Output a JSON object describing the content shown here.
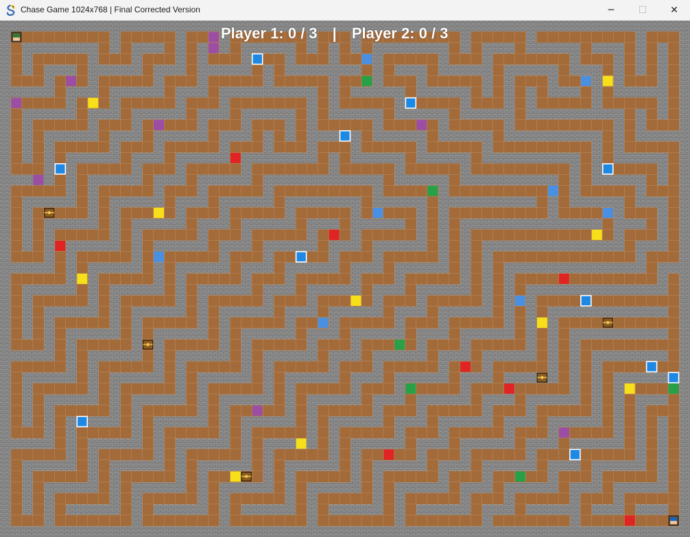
{
  "window": {
    "title": "Chase Game 1024x768 | Final Corrected Version",
    "app_icon": "snake-app-icon",
    "controls": {
      "minimize": "─",
      "maximize": "☐",
      "close": "✕"
    }
  },
  "hud": {
    "player1": "Player 1: 0 / 3",
    "separator": "|",
    "player2": "Player 2: 0 / 3"
  },
  "colors": {
    "floor": "#a36a3a",
    "wall": "#8e8e8e",
    "wall_line": "#6f6f6f",
    "purple": "#9b4ea3",
    "blue": "#4a90e2",
    "blue_bright": "#1e88e5",
    "green": "#27a047",
    "red": "#e02424",
    "yellow": "#f7e01a",
    "chest": "#8b5a1e"
  },
  "maze": {
    "cols": 63,
    "rows": 47,
    "rowsData": [
      "###############################################################",
      "#.........#.....#...#.......#...#.........#.....#.........#...#",
      "#.#######.#.###.#.#.#.#####.#.#.#.#######.#.###.#####.###.#.#.#",
      "#.#.....#...#...#.#...#...#...#...#.....#...#.......#...#.#.#.#",
      "#.#.###.#####.###.#####.#.#######.#.###.#####.#####.###.#.#.#.#",
      "#...#...#.....#...#.....#.....#...#...#.....#.#...#...#.#...#.#",
      "#####.###.#####.###.#########.#.#####.#####.#.#.#.###.#.#####.#",
      "#.....#...#.....#...#.......#.#.....#.....#...#.#.....#.....#.#",
      "#.#####.###.#####.###.#####.#.#####.#####.#####.#########.#.#.#",
      "#.#.....#...#.....#...#...#.#.....#.....#.....#.........#.#...#",
      "#.#.#####.###.#####.###.#.#.#####.#####.#####.#########.#.#####",
      "#.#.#.....#...#.....#...#...#...#.....#.....#.........#.#.....#",
      "#.#.#.#####.###.#####.#######.#.#####.#####.#########.#.#####.#",
      "#...#.#.....#...#.....#.......#.....#.....#.........#.#.....#.#",
      "#####.#.#####.###.#####.###########.#####.#########.#.#####.#.#",
      "#.....#.#.....#...#.....#.........#.....#.........#.#.....#...#",
      "#.#####.#.#####.###.#####.#######.#####.#########.#.#####.###.#",
      "#.#.....#.#.....#...#.....#.....#.....#.#.........#.....#...#.#",
      "#.#.#####.#.#####.###.#####.###.#####.#.#.#############.###.#.#",
      "#.#.#.....#.#.....#...#.....#...#.....#.#.#.............#...#.#",
      "#.#.#.#####.#.#####.###.#####.###.#####.#.#.#############.###.#",
      "#...#.#.....#.#.....#...#.....#...#.....#.#.#.............#...#",
      "#####.#.#####.#.#####.###.#####.###.#####.#.#.#############.###",
      "#.....#.#.....#.#.....#...#.....#...#.....#.#.#.............#.#",
      "#.#####.#.#####.#.#####.###.#####.###.#####.#.#.#############.#",
      "#.#.....#.#.....#.#.....#...#.....#...#.....#.#.#.............#",
      "#.#.#####.#.#####.#.#####.###.#####.###.#####.#.#.###########.#",
      "#.#.#.....#.#.....#.#.....#...#.....#...#.....#.#.#...........#",
      "#.#.#.#####.#.#####.#.#####.###.#####.###.#####.#.#.#########.#",
      "#...#.#.....#.#.....#.#.....#...#.....#...#.....#.#.#.........#",
      "#####.#.#####.#.#####.#.#####.###.#####.###.#####.#.#.#######.#",
      "#.....#.#.....#.#.....#.#.....#...#.....#...#.....#.#.#.......#",
      "#.#####.#.#####.#.#####.#.#####.###.#####.###.#####.#.#.#####.#",
      "#.#.....#.#.....#.#.....#.#.....#...#.....#...#.....#.#.#.....#",
      "#.#.#####.#.#####.#.#####.#.#####.###.#####.###.#####.#.#.###.#",
      "#.#.#.....#.#.....#.#.....#.#.....#...#.....#...#.....#.#.#...#",
      "#.#.#.#####.#.#####.#.#####.#.#####.###.#####.###.#####.#.#.#.#",
      "#...#.#.....#.#.....#.#.....#.#.....#...#.....#...#.....#.#.#.#",
      "#####.#.#####.#.#####.#.#####.#.#####.###.#####.###.#####.#.#.#",
      "#.....#.#.....#.#.....#.#.....#.#.....#...#.....#...#.....#.#.#",
      "#.#####.#.#####.#.#####.#.#####.#.#####.###.#####.###.#####.#.#",
      "#.#.....#.#.....#.#.....#.#.....#.#.....#...#.....#...#.....#.#",
      "#.#.#####.#.#####.#.#####.#.#####.#.#####.###.#####.###.#####.#",
      "#.#.#.....#.#.....#.#.....#.#.....#.#.....#...#.....#...#.....#",
      "#.#.#.#####.#.#####.#.#####.#.#####.#.#####.###.#####.###.###.#",
      "#...#.......#.......#.......#.......#.......#.......#.........#",
      "###############################################################"
    ]
  },
  "items": [
    {
      "c": 19,
      "r": 1,
      "t": "purple"
    },
    {
      "c": 19,
      "r": 2,
      "t": "purple"
    },
    {
      "c": 23,
      "r": 3,
      "t": "blue_bright"
    },
    {
      "c": 33,
      "r": 3,
      "t": "blue"
    },
    {
      "c": 6,
      "r": 5,
      "t": "purple"
    },
    {
      "c": 33,
      "r": 5,
      "t": "green"
    },
    {
      "c": 53,
      "r": 5,
      "t": "blue"
    },
    {
      "c": 55,
      "r": 5,
      "t": "yellow"
    },
    {
      "c": 1,
      "r": 7,
      "t": "purple"
    },
    {
      "c": 8,
      "r": 7,
      "t": "yellow"
    },
    {
      "c": 37,
      "r": 7,
      "t": "blue_bright"
    },
    {
      "c": 14,
      "r": 9,
      "t": "purple"
    },
    {
      "c": 38,
      "r": 9,
      "t": "purple"
    },
    {
      "c": 31,
      "r": 10,
      "t": "blue_bright"
    },
    {
      "c": 21,
      "r": 12,
      "t": "red"
    },
    {
      "c": 5,
      "r": 13,
      "t": "blue_bright"
    },
    {
      "c": 55,
      "r": 13,
      "t": "blue_bright"
    },
    {
      "c": 3,
      "r": 14,
      "t": "purple"
    },
    {
      "c": 39,
      "r": 15,
      "t": "green"
    },
    {
      "c": 50,
      "r": 15,
      "t": "blue"
    },
    {
      "c": 4,
      "r": 17,
      "t": "chest"
    },
    {
      "c": 14,
      "r": 17,
      "t": "yellow"
    },
    {
      "c": 34,
      "r": 17,
      "t": "blue"
    },
    {
      "c": 55,
      "r": 17,
      "t": "blue"
    },
    {
      "c": 30,
      "r": 19,
      "t": "red"
    },
    {
      "c": 54,
      "r": 19,
      "t": "yellow"
    },
    {
      "c": 5,
      "r": 20,
      "t": "red"
    },
    {
      "c": 14,
      "r": 21,
      "t": "blue"
    },
    {
      "c": 27,
      "r": 21,
      "t": "blue_bright"
    },
    {
      "c": 7,
      "r": 23,
      "t": "yellow"
    },
    {
      "c": 51,
      "r": 23,
      "t": "red"
    },
    {
      "c": 32,
      "r": 25,
      "t": "yellow"
    },
    {
      "c": 47,
      "r": 25,
      "t": "blue"
    },
    {
      "c": 53,
      "r": 25,
      "t": "blue_bright"
    },
    {
      "c": 29,
      "r": 27,
      "t": "blue"
    },
    {
      "c": 49,
      "r": 27,
      "t": "yellow"
    },
    {
      "c": 55,
      "r": 27,
      "t": "chest"
    },
    {
      "c": 13,
      "r": 29,
      "t": "chest"
    },
    {
      "c": 36,
      "r": 29,
      "t": "green"
    },
    {
      "c": 42,
      "r": 31,
      "t": "red"
    },
    {
      "c": 59,
      "r": 31,
      "t": "blue_bright"
    },
    {
      "c": 49,
      "r": 32,
      "t": "chest"
    },
    {
      "c": 61,
      "r": 32,
      "t": "blue_bright"
    },
    {
      "c": 37,
      "r": 33,
      "t": "green"
    },
    {
      "c": 46,
      "r": 33,
      "t": "red"
    },
    {
      "c": 57,
      "r": 33,
      "t": "yellow"
    },
    {
      "c": 61,
      "r": 33,
      "t": "green"
    },
    {
      "c": 23,
      "r": 35,
      "t": "purple"
    },
    {
      "c": 7,
      "r": 36,
      "t": "blue_bright"
    },
    {
      "c": 51,
      "r": 37,
      "t": "purple"
    },
    {
      "c": 27,
      "r": 38,
      "t": "yellow"
    },
    {
      "c": 35,
      "r": 39,
      "t": "red"
    },
    {
      "c": 52,
      "r": 39,
      "t": "blue_bright"
    },
    {
      "c": 21,
      "r": 41,
      "t": "yellow"
    },
    {
      "c": 22,
      "r": 41,
      "t": "chest"
    },
    {
      "c": 47,
      "r": 41,
      "t": "green"
    },
    {
      "c": 57,
      "r": 45,
      "t": "red"
    }
  ],
  "players": [
    {
      "name": "player-1",
      "c": 1,
      "r": 1,
      "color": "#2e7d32"
    },
    {
      "name": "player-2",
      "c": 61,
      "r": 45,
      "color": "#1565c0"
    }
  ]
}
